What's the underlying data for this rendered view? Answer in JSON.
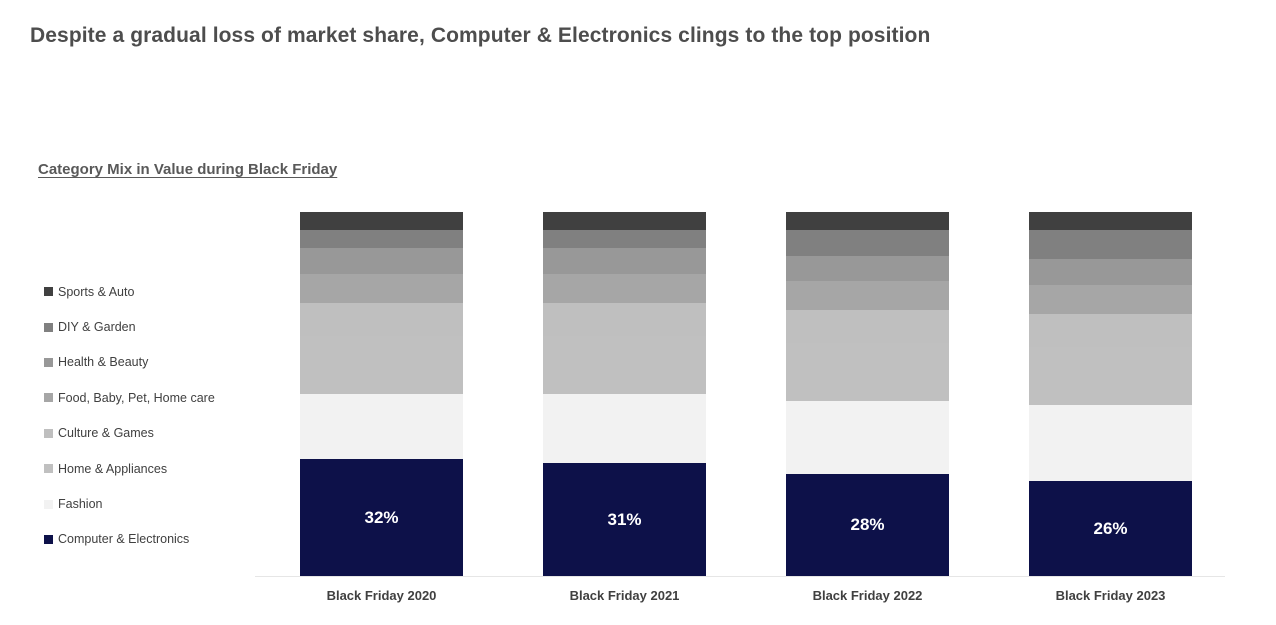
{
  "page_title": "Despite a gradual loss of market share, Computer & Electronics clings to the top position",
  "chart_subtitle": "Category Mix in Value during Black Friday",
  "colors": {
    "title_text": "#4d4d4d",
    "subtitle_text": "#595959",
    "label_text": "#404040",
    "axis_line": "#e6e6e6",
    "background": "#ffffff",
    "series": {
      "sports_auto": "#404040",
      "diy_garden": "#808080",
      "health_beauty": "#989898",
      "food_baby_pet_home_care": "#a6a6a6",
      "culture_games": "#bfbfbf",
      "home_appliances": "#c0c0c0",
      "fashion": "#f2f2f2",
      "computer_electronics": "#0d1149"
    }
  },
  "legend": {
    "position": "left",
    "items": [
      {
        "label": "Sports & Auto",
        "color": "#404040",
        "swatch_icon": "square-marker-icon"
      },
      {
        "label": "DIY & Garden",
        "color": "#808080",
        "swatch_icon": "square-marker-icon"
      },
      {
        "label": "Health & Beauty",
        "color": "#989898",
        "swatch_icon": "square-marker-icon"
      },
      {
        "label": "Food, Baby, Pet, Home care",
        "color": "#a6a6a6",
        "swatch_icon": "square-marker-icon"
      },
      {
        "label": "Culture & Games",
        "color": "#bfbfbf",
        "swatch_icon": "square-marker-icon"
      },
      {
        "label": "Home & Appliances",
        "color": "#c0c0c0",
        "swatch_icon": "square-marker-icon"
      },
      {
        "label": "Fashion",
        "color": "#f2f2f2",
        "swatch_icon": "square-marker-icon"
      },
      {
        "label": "Computer & Electronics",
        "color": "#0d1149",
        "swatch_icon": "square-marker-icon"
      }
    ]
  },
  "chart_data": {
    "type": "bar",
    "variant": "stacked-100-percent",
    "title": "Category Mix in Value during Black Friday",
    "xlabel": "",
    "ylabel": "",
    "ylim": [
      0,
      100
    ],
    "grid": false,
    "legend_position": "left",
    "categories": [
      "Black Friday 2020",
      "Black Friday 2021",
      "Black Friday 2022",
      "Black Friday 2023"
    ],
    "stack_order_bottom_to_top": [
      "Computer & Electronics",
      "Fashion",
      "Home & Appliances",
      "Culture & Games",
      "Food, Baby, Pet, Home care",
      "Health & Beauty",
      "DIY & Garden",
      "Sports & Auto"
    ],
    "series": [
      {
        "name": "Computer & Electronics",
        "color": "#0d1149",
        "values": [
          32,
          31,
          28,
          26
        ],
        "value_labels": [
          "32%",
          "31%",
          "28%",
          "26%"
        ]
      },
      {
        "name": "Fashion",
        "color": "#f2f2f2",
        "values": [
          18,
          19,
          20,
          21
        ],
        "value_labels": [
          "",
          "",
          "",
          ""
        ]
      },
      {
        "name": "Home & Appliances",
        "color": "#c0c0c0",
        "values": [
          16,
          16,
          16,
          16
        ],
        "value_labels": [
          "",
          "",
          "",
          ""
        ]
      },
      {
        "name": "Culture & Games",
        "color": "#bfbfbf",
        "values": [
          9,
          9,
          9,
          9
        ],
        "value_labels": [
          "",
          "",
          "",
          ""
        ]
      },
      {
        "name": "Food, Baby, Pet, Home care",
        "color": "#a6a6a6",
        "values": [
          8,
          8,
          8,
          8
        ],
        "value_labels": [
          "",
          "",
          "",
          ""
        ]
      },
      {
        "name": "Health & Beauty",
        "color": "#989898",
        "values": [
          7,
          7,
          7,
          7
        ],
        "value_labels": [
          "",
          "",
          "",
          ""
        ]
      },
      {
        "name": "DIY & Garden",
        "color": "#808080",
        "values": [
          5,
          5,
          7,
          8
        ],
        "value_labels": [
          "",
          "",
          "",
          ""
        ]
      },
      {
        "name": "Sports & Auto",
        "color": "#404040",
        "values": [
          5,
          5,
          5,
          5
        ],
        "value_labels": [
          "",
          "",
          "",
          ""
        ]
      }
    ]
  }
}
